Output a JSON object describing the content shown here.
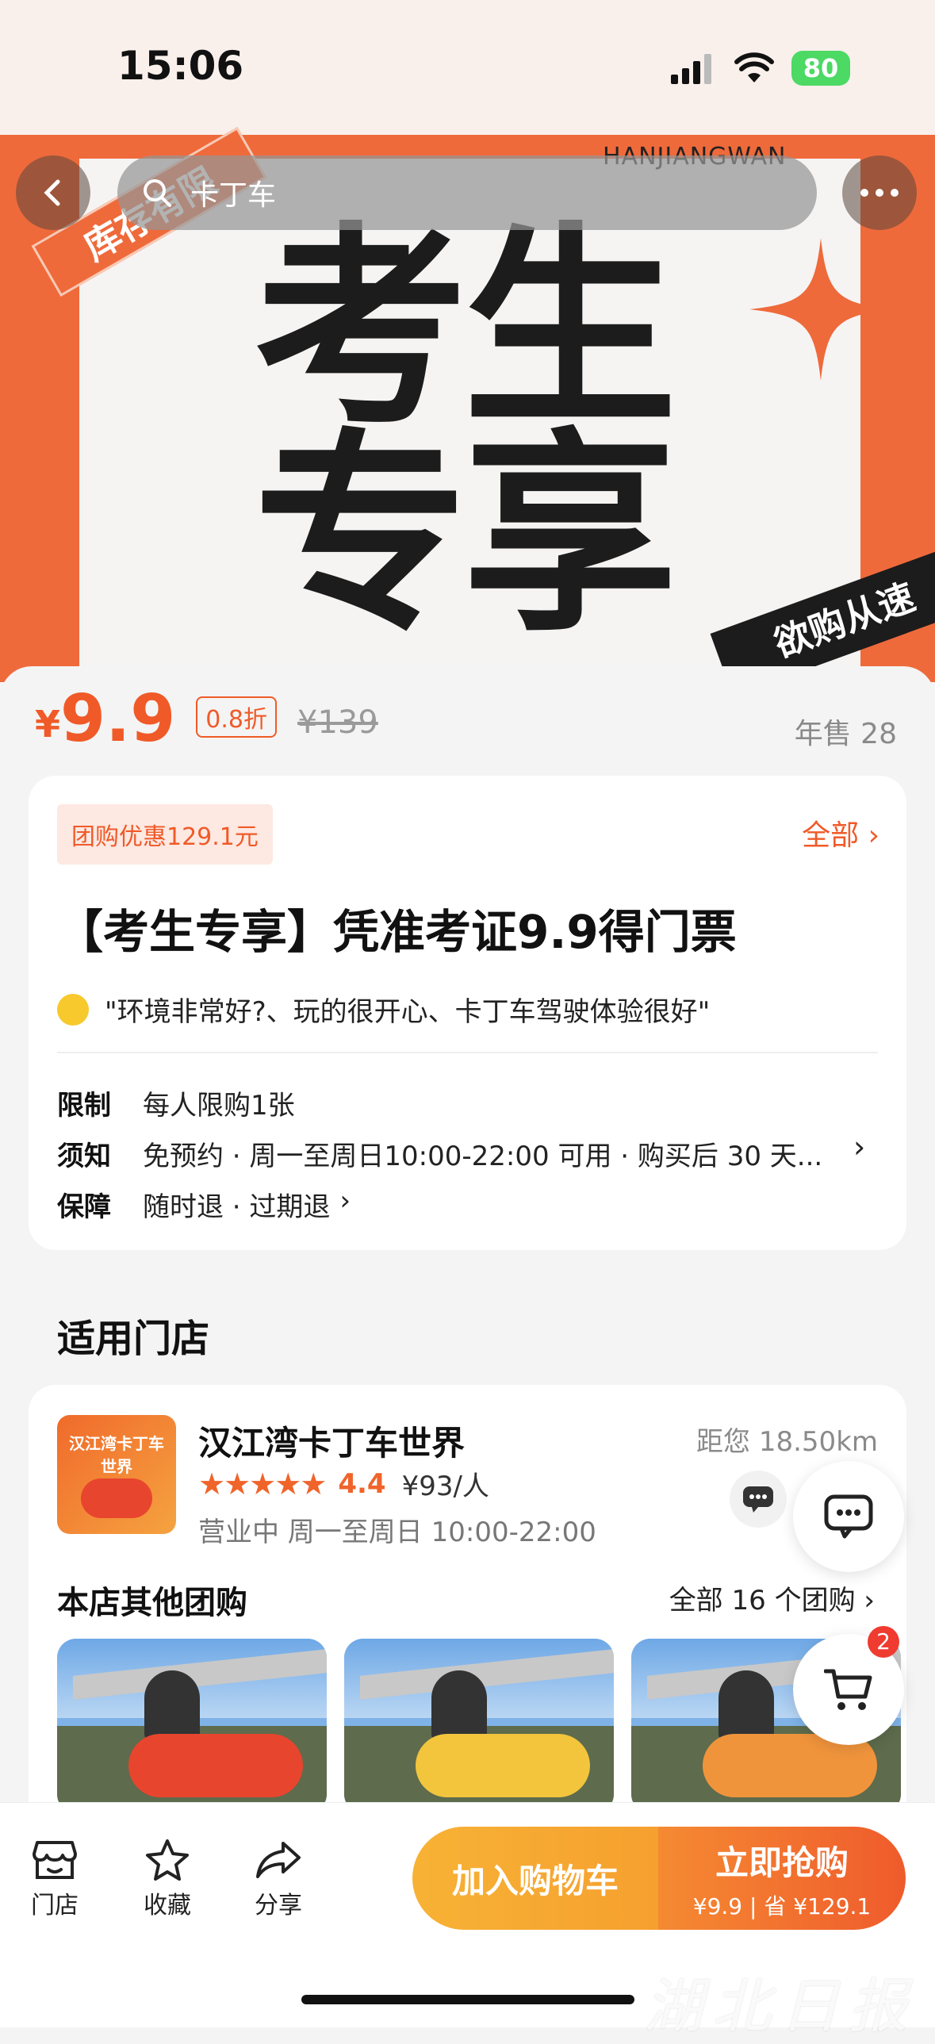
{
  "status_bar": {
    "time": "15:06",
    "battery": "80"
  },
  "hero": {
    "stock_tag": "库存有限",
    "brand": "HANJIANGWAN",
    "headline_line1": "考生",
    "headline_line2": "专享",
    "corner_tag": "欲购从速"
  },
  "search": {
    "query": "卡丁车"
  },
  "price": {
    "currency": "¥",
    "current": "9.9",
    "discount": "0.8折",
    "original": "¥139",
    "annual_sales": "年售 28"
  },
  "deal_card": {
    "coupon": "团购优惠129.1元",
    "all_label": "全部",
    "title": "【考生专享】凭准考证9.9得门票",
    "review": "\"环境非常好?、玩的很开心、卡丁车驾驶体验很好\"",
    "rules": [
      {
        "key": "限制",
        "value": "每人限购1张"
      },
      {
        "key": "须知",
        "value": "免预约 · 周一至周日10:00-22:00 可用 · 购买后 30 天..."
      },
      {
        "key": "保障",
        "value": "随时退 · 过期退"
      }
    ]
  },
  "stores_section": {
    "title": "适用门店"
  },
  "store": {
    "thumb_text": "汉江湾卡丁车世界",
    "name": "汉江湾卡丁车世界",
    "distance": "距您 18.50km",
    "stars": "★★★★★",
    "score": "4.4",
    "avg_price": "¥93/人",
    "hours": "营业中  周一至周日 10:00-22:00",
    "other_title": "本店其他团购",
    "other_all": "全部 16 个团购"
  },
  "cart_badge": "2",
  "bottom_bar": {
    "tabs": [
      {
        "label": "门店",
        "icon": "store-icon"
      },
      {
        "label": "收藏",
        "icon": "star-icon"
      },
      {
        "label": "分享",
        "icon": "share-icon"
      }
    ],
    "add_to_cart": "加入购物车",
    "buy_now": "立即抢购",
    "buy_now_sub": "¥9.9 | 省 ¥129.1"
  },
  "watermark": "湖北日报",
  "colors": {
    "accent": "#f05a28",
    "hero_orange": "#ef6a3b",
    "cart_yellow": "#f7b235"
  }
}
